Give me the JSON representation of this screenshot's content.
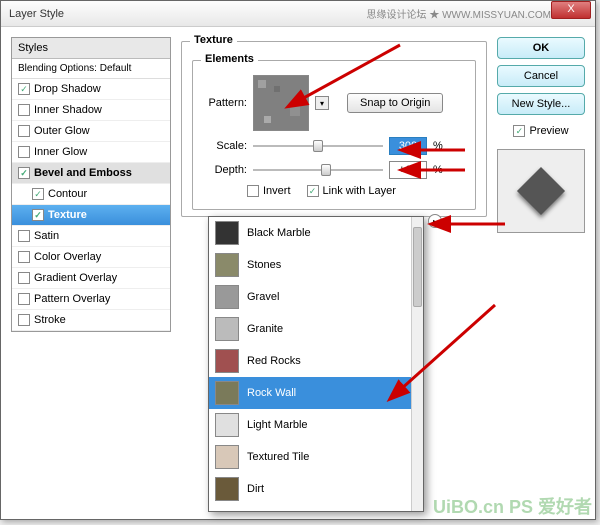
{
  "dialog": {
    "title": "Layer Style",
    "watermark_top": "思缘设计论坛 ★ WWW.MISSYUAN.COM",
    "close_x": "X"
  },
  "sidebar": {
    "header": "Styles",
    "blending": "Blending Options: Default",
    "items": [
      {
        "label": "Drop Shadow",
        "checked": true,
        "indent": false,
        "state": ""
      },
      {
        "label": "Inner Shadow",
        "checked": false,
        "indent": false,
        "state": ""
      },
      {
        "label": "Outer Glow",
        "checked": false,
        "indent": false,
        "state": ""
      },
      {
        "label": "Inner Glow",
        "checked": false,
        "indent": false,
        "state": ""
      },
      {
        "label": "Bevel and Emboss",
        "checked": true,
        "indent": false,
        "state": "selhdr"
      },
      {
        "label": "Contour",
        "checked": true,
        "indent": true,
        "state": ""
      },
      {
        "label": "Texture",
        "checked": true,
        "indent": true,
        "state": "sel"
      },
      {
        "label": "Satin",
        "checked": false,
        "indent": false,
        "state": ""
      },
      {
        "label": "Color Overlay",
        "checked": false,
        "indent": false,
        "state": ""
      },
      {
        "label": "Gradient Overlay",
        "checked": false,
        "indent": false,
        "state": ""
      },
      {
        "label": "Pattern Overlay",
        "checked": false,
        "indent": false,
        "state": ""
      },
      {
        "label": "Stroke",
        "checked": false,
        "indent": false,
        "state": ""
      }
    ]
  },
  "texture": {
    "legend_outer": "Texture",
    "legend_inner": "Elements",
    "pattern_label": "Pattern:",
    "snap_label": "Snap to Origin",
    "scale_label": "Scale:",
    "scale_value": "300",
    "depth_label": "Depth:",
    "depth_value": "+10",
    "pct": "%",
    "invert_label": "Invert",
    "link_label": "Link with Layer",
    "invert_checked": false,
    "link_checked": true
  },
  "buttons": {
    "ok": "OK",
    "cancel": "Cancel",
    "newstyle": "New Style...",
    "preview_label": "Preview"
  },
  "patterns": {
    "items": [
      {
        "label": "Black Marble",
        "color": "#333"
      },
      {
        "label": "Stones",
        "color": "#8a8a6a"
      },
      {
        "label": "Gravel",
        "color": "#999"
      },
      {
        "label": "Granite",
        "color": "#bbb"
      },
      {
        "label": "Red Rocks",
        "color": "#a05050"
      },
      {
        "label": "Rock Wall",
        "color": "#7a7a5a"
      },
      {
        "label": "Light Marble",
        "color": "#e0e0e0"
      },
      {
        "label": "Textured Tile",
        "color": "#d8c8b8"
      },
      {
        "label": "Dirt",
        "color": "#6a5a3a"
      }
    ],
    "selected_index": 5
  },
  "watermark_bottom": "UiBO.cn PS 爱好者"
}
